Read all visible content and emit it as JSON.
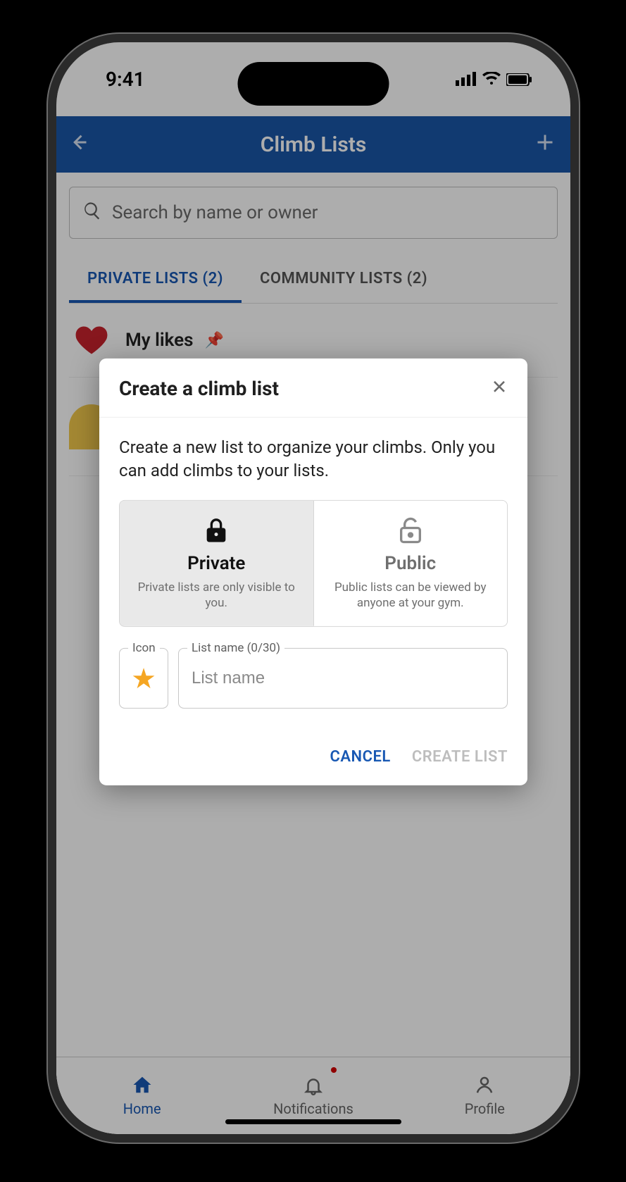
{
  "status": {
    "time": "9:41"
  },
  "appbar": {
    "title": "Climb Lists"
  },
  "search": {
    "placeholder": "Search by name or owner"
  },
  "tabs": {
    "private": "PRIVATE LISTS (2)",
    "community": "COMMUNITY LISTS (2)"
  },
  "list": {
    "item0_label": "My likes"
  },
  "modal": {
    "title": "Create a climb list",
    "description": "Create a new list to organize your climbs. Only you can add climbs to your lists.",
    "private_title": "Private",
    "private_sub": "Private lists are only visible to you.",
    "public_title": "Public",
    "public_sub": "Public lists can be viewed by anyone at your gym.",
    "icon_label": "Icon",
    "name_label": "List name (0/30)",
    "name_placeholder": "List name",
    "cancel": "CANCEL",
    "create": "CREATE LIST"
  },
  "nav": {
    "home": "Home",
    "notifications": "Notifications",
    "profile": "Profile"
  }
}
